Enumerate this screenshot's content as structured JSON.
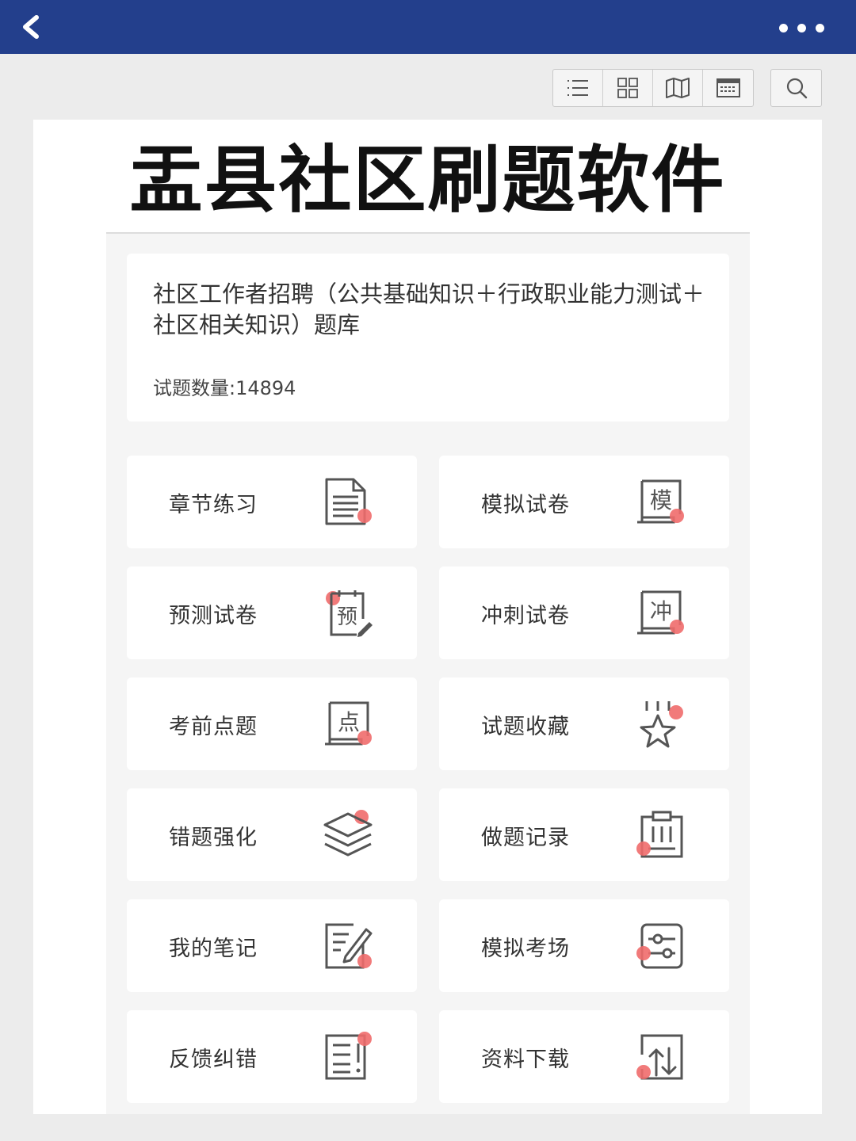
{
  "header": {
    "back_icon": "chevron-left-icon",
    "more_icon": "more-dots-icon",
    "bar_color": "#233f8c"
  },
  "toolbar": {
    "buttons": [
      {
        "icon": "list-icon"
      },
      {
        "icon": "grid-icon"
      },
      {
        "icon": "map-icon"
      },
      {
        "icon": "calendar-icon"
      }
    ],
    "search_icon": "search-icon"
  },
  "page": {
    "title": "盂县社区刷题软件"
  },
  "bank": {
    "title": "社区工作者招聘（公共基础知识＋行政职业能力测试＋社区相关知识）题库",
    "count_label": "试题数量:14894"
  },
  "tiles": [
    {
      "label": "章节练习",
      "icon": "document-icon"
    },
    {
      "label": "模拟试卷",
      "icon": "mock-paper-icon",
      "glyph": "模"
    },
    {
      "label": "预测试卷",
      "icon": "forecast-paper-icon",
      "glyph": "预"
    },
    {
      "label": "冲刺试卷",
      "icon": "sprint-paper-icon",
      "glyph": "冲"
    },
    {
      "label": "考前点题",
      "icon": "key-points-icon",
      "glyph": "点"
    },
    {
      "label": "试题收藏",
      "icon": "star-icon"
    },
    {
      "label": "错题强化",
      "icon": "layers-icon"
    },
    {
      "label": "做题记录",
      "icon": "clipboard-icon"
    },
    {
      "label": "我的笔记",
      "icon": "note-edit-icon"
    },
    {
      "label": "模拟考场",
      "icon": "sliders-icon"
    },
    {
      "label": "反馈纠错",
      "icon": "feedback-icon"
    },
    {
      "label": "资料下载",
      "icon": "download-icon"
    }
  ],
  "colors": {
    "accent_dot": "#ef6b6b",
    "icon_stroke": "#555555"
  }
}
